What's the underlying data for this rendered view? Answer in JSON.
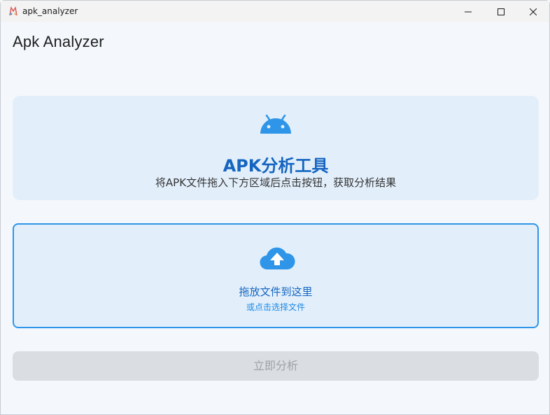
{
  "window": {
    "title": "apk_analyzer",
    "controls": {
      "minimize_icon": "minimize-icon",
      "maximize_icon": "maximize-icon",
      "close_icon": "close-icon"
    }
  },
  "header": {
    "title": "Apk Analyzer"
  },
  "hero": {
    "icon": "android-icon",
    "title": "APK分析工具",
    "subtitle": "将APK文件拖入下方区域后点击按钮，获取分析结果"
  },
  "drop_zone": {
    "icon": "cloud-upload-icon",
    "primary_text": "拖放文件到这里",
    "secondary_text": "或点击选择文件"
  },
  "actions": {
    "analyze_label": "立即分析",
    "analyze_enabled": false
  },
  "colors": {
    "accent": "#1565c0",
    "accent_light": "#2e95e8",
    "card_bg": "#e2effb",
    "disabled_bg": "#dadde1",
    "disabled_text": "#9ea3a9"
  }
}
